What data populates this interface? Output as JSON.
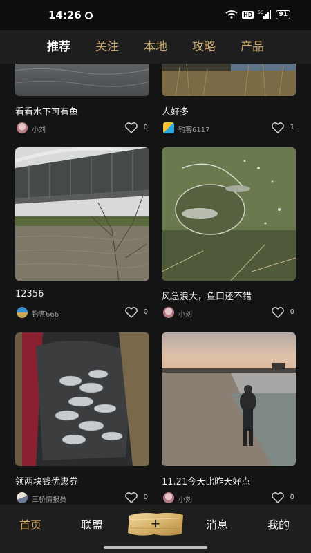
{
  "status_bar": {
    "time": "14:26",
    "hd_label": "HD",
    "network": "5G",
    "battery": "91"
  },
  "top_tabs": [
    {
      "label": "推荐",
      "active": true
    },
    {
      "label": "关注",
      "active": false
    },
    {
      "label": "本地",
      "active": false
    },
    {
      "label": "攻略",
      "active": false
    },
    {
      "label": "产品",
      "active": false
    }
  ],
  "feed": {
    "posts": [
      {
        "title": "看看水下可有鱼",
        "author": "小刘",
        "likes": "0"
      },
      {
        "title": "人好多",
        "author": "钓客6117",
        "likes": "1"
      },
      {
        "title": "12356",
        "author": "钓客666",
        "likes": "0"
      },
      {
        "title": "风急浪大，鱼口还不错",
        "author": "小刘",
        "likes": "0"
      },
      {
        "title": "领两块钱优惠券",
        "author": "三桥情报员",
        "likes": "0"
      },
      {
        "title": "11.21今天比昨天好点",
        "author": "小刘",
        "likes": "0"
      }
    ]
  },
  "bottom_nav": {
    "home": "首页",
    "alliance": "联盟",
    "add": "+",
    "messages": "消息",
    "mine": "我的"
  },
  "colors": {
    "accent_gold": "#c9a96a",
    "active_nav": "#d7a85a",
    "background": "#141414",
    "bar": "#1e1e1e"
  }
}
